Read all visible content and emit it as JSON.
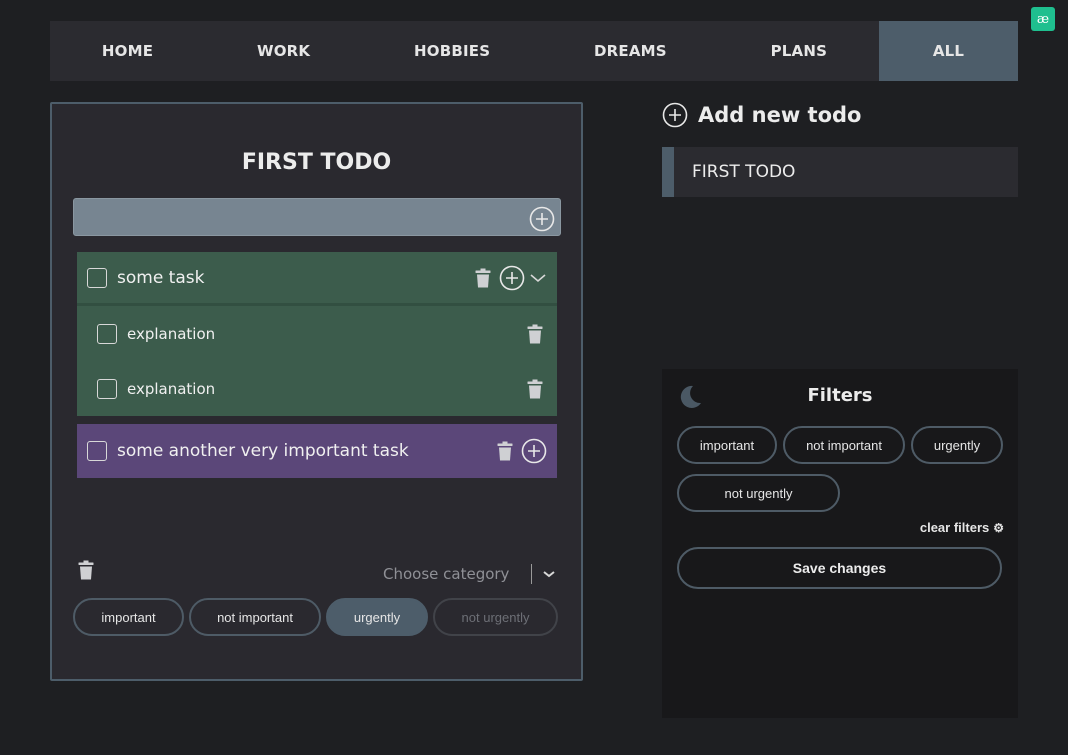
{
  "nav": {
    "tabs": [
      {
        "label": "HOME"
      },
      {
        "label": "WORK"
      },
      {
        "label": "HOBBIES"
      },
      {
        "label": "DREAMS"
      },
      {
        "label": "PLANS"
      },
      {
        "label": "ALL",
        "active": true
      }
    ]
  },
  "extension_badge": "æ",
  "todo": {
    "title": "FIRST TODO",
    "new_task_value": "",
    "tasks": [
      {
        "text": "some task",
        "color": "#3c5c4c",
        "checked": false,
        "expanded": true,
        "subtasks": [
          {
            "text": "explanation",
            "checked": false
          },
          {
            "text": "explanation",
            "checked": false
          }
        ]
      },
      {
        "text": "some another very important task",
        "color": "#5b4779",
        "checked": false
      }
    ],
    "category_placeholder": "Choose category",
    "tags": [
      {
        "label": "important",
        "state": "default"
      },
      {
        "label": "not important",
        "state": "default"
      },
      {
        "label": "urgently",
        "state": "selected"
      },
      {
        "label": "not urgently",
        "state": "disabled"
      }
    ]
  },
  "sidebar": {
    "add_todo_label": "Add new todo",
    "todos": [
      {
        "title": "FIRST TODO"
      }
    ]
  },
  "filters": {
    "title": "Filters",
    "options": [
      {
        "label": "important"
      },
      {
        "label": "not important"
      },
      {
        "label": "urgently"
      },
      {
        "label": "not urgently"
      }
    ],
    "clear_label": "clear filters",
    "clear_icon": "⚙",
    "save_label": "Save changes"
  },
  "colors": {
    "accent": "#4d5d6a",
    "green_task": "#3c5c4c",
    "purple_task": "#5b4779",
    "background": "#1e1f22",
    "brand_badge": "#1fbf8f"
  }
}
